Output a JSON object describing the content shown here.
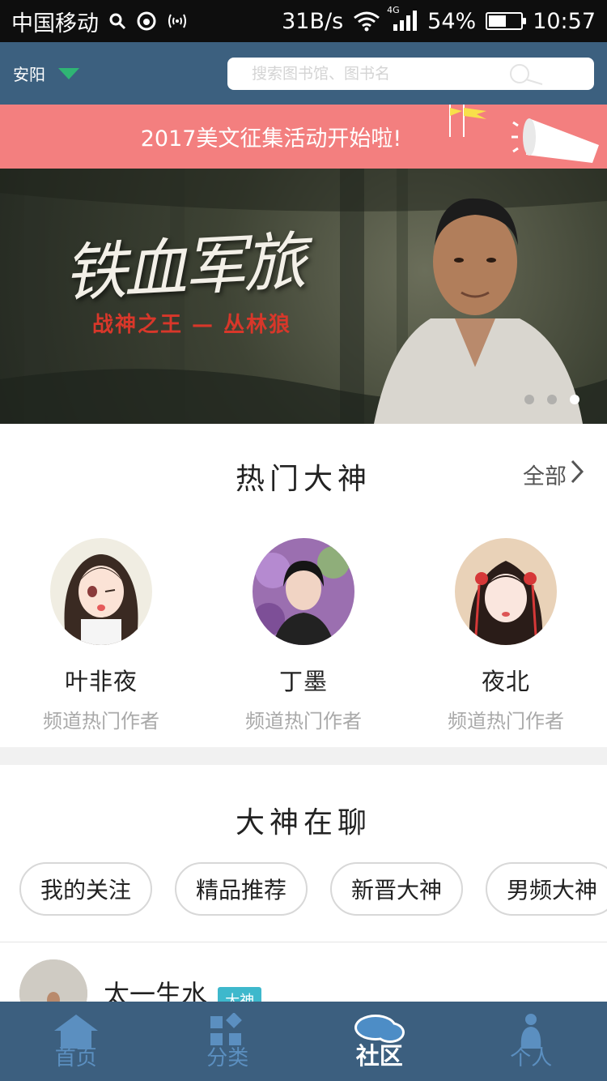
{
  "status_bar": {
    "carrier": "中国移动",
    "net_speed": "31B/s",
    "signal_type": "4G",
    "battery": "54%",
    "battery_level": 0.54,
    "time": "10:57"
  },
  "header": {
    "city": "安阳",
    "search_placeholder": "搜索图书馆、图书名"
  },
  "promo": {
    "text": "2017美文征集活动开始啦!"
  },
  "carousel": {
    "title": "铁血军旅",
    "subtitle": "战神之王 — 丛林狼",
    "slide_count": 3,
    "active_index": 2
  },
  "hot_authors": {
    "title": "热门大神",
    "more_label": "全部",
    "items": [
      {
        "name": "叶非夜",
        "role": "频道热门作者"
      },
      {
        "name": "丁墨",
        "role": "频道热门作者"
      },
      {
        "name": "夜北",
        "role": "频道热门作者"
      }
    ]
  },
  "chat": {
    "title": "大神在聊",
    "tabs": [
      "我的关注",
      "精品推荐",
      "新晋大神",
      "男频大神"
    ],
    "first_post": {
      "user": "太一生水",
      "badge": "大神"
    }
  },
  "tabbar": {
    "items": [
      {
        "label": "首页",
        "icon": "home-icon"
      },
      {
        "label": "分类",
        "icon": "category-icon"
      },
      {
        "label": "社区",
        "icon": "community-icon"
      },
      {
        "label": "个人",
        "icon": "person-icon"
      }
    ],
    "active": 2,
    "inactive_color": "#5b8fc0",
    "active_color": "#ffffff"
  },
  "colors": {
    "header_bg": "#3c607f",
    "promo_bg": "#f37f7f",
    "accent_green": "#2fb574",
    "badge_blue": "#3eb8cc"
  }
}
